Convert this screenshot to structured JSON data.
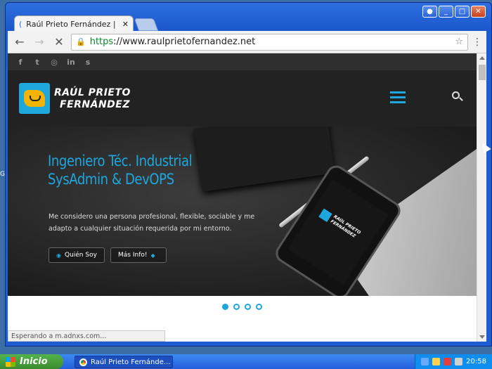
{
  "browser": {
    "tab_title": "Raúl Prieto Fernández | Inge",
    "url_scheme": "https",
    "url_host": "://www.raulprietofernandez.net",
    "status_text": "Esperando a m.adnxs.com..."
  },
  "site": {
    "social_icons": [
      "facebook-icon",
      "twitter-icon",
      "instagram-icon",
      "linkedin-icon",
      "skype-icon"
    ],
    "social_glyphs": [
      "f",
      "t",
      "◎",
      "in",
      "s"
    ],
    "name_line1": "RAÚL PRIETO",
    "name_line2": "FERNÁNDEZ",
    "accent_color": "#1ea7dd"
  },
  "hero": {
    "title_line1": "Ingeniero Téc. Industrial",
    "title_line2": "SysAdmin & DevOPS",
    "text": "Me considero una persona profesional, flexible, sociable y me adapto a cualquier situación requerida por mi entorno.",
    "btn_quien": "Quién Soy",
    "btn_mas": "Más Info!",
    "phone_text_line1": "RAÚL PRIETO",
    "phone_text_line2": "FERNÁNDEZ"
  },
  "slider": {
    "dots": 4,
    "active_index": 0
  },
  "taskbar": {
    "start_label": "Inicio",
    "task_label": "Raúl Prieto Fernánde...",
    "clock": "20:58"
  },
  "gutter_letter": "G"
}
